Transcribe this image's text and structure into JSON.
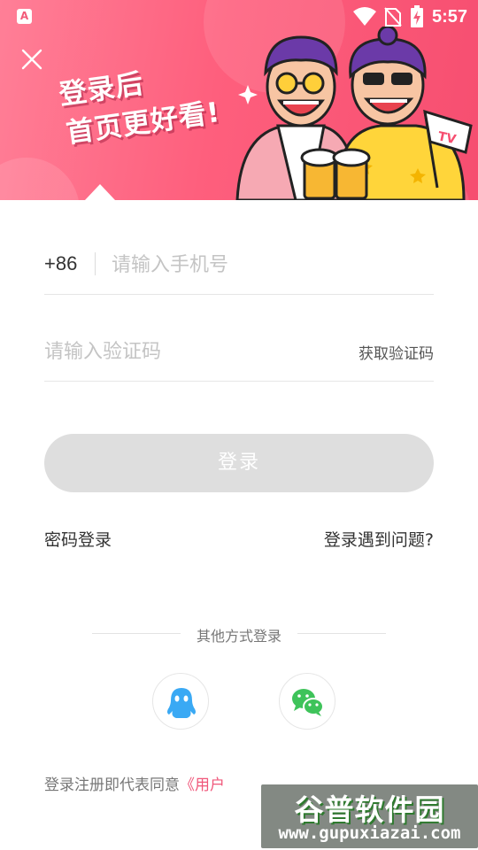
{
  "status_bar": {
    "app_icon_letter": "A",
    "time": "5:57",
    "icons": [
      "wifi-icon",
      "no-sim-icon",
      "battery-charging-icon"
    ]
  },
  "header": {
    "close_icon": "close-icon",
    "slogan_line1": "登录后",
    "slogan_line2": "首页更好看!",
    "flag_text": "TV"
  },
  "form": {
    "country_code": "+86",
    "phone_placeholder": "请输入手机号",
    "phone_value": "",
    "code_placeholder": "请输入验证码",
    "code_value": "",
    "get_code_label": "获取验证码",
    "login_label": "登录",
    "login_enabled": false,
    "password_login_label": "密码登录",
    "trouble_label": "登录遇到问题?"
  },
  "other_login": {
    "title": "其他方式登录",
    "methods": [
      {
        "name": "qq",
        "icon": "qq-icon",
        "color": "#3aa9f4"
      },
      {
        "name": "wechat",
        "icon": "wechat-icon",
        "color": "#3ec35a"
      }
    ]
  },
  "agreement": {
    "prefix": "登录注册即代表同意",
    "link_visible": "《用户"
  },
  "watermark": {
    "logo": "谷普软件园",
    "url": "www.gupuxiazai.com"
  },
  "colors": {
    "brand_pink": "#f64e70",
    "link_pink": "#f0577a",
    "disabled_button": "#dedede"
  }
}
